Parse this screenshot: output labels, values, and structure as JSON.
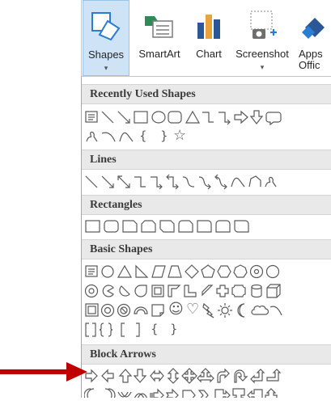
{
  "ribbon": {
    "buttons": [
      {
        "label": "Shapes",
        "icon": "shapes-icon"
      },
      {
        "label": "SmartArt",
        "icon": "smartart-icon"
      },
      {
        "label": "Chart",
        "icon": "chart-icon"
      },
      {
        "label": "Screenshot",
        "icon": "screenshot-icon"
      },
      {
        "label": "Apps",
        "label2": "Offic",
        "icon": "apps-for-office-icon"
      }
    ],
    "dropdown_caret": "▾"
  },
  "gallery": {
    "sections": [
      {
        "title": "Recently Used Shapes"
      },
      {
        "title": "Lines"
      },
      {
        "title": "Rectangles"
      },
      {
        "title": "Basic Shapes"
      },
      {
        "title": "Block Arrows"
      }
    ],
    "inline_text": {
      "bracket_left": "{",
      "bracket_right": "}",
      "star": "☆",
      "smiley": "☺",
      "heart": "♡"
    }
  },
  "colors": {
    "shape_stroke": "#5a5a5a",
    "header_bg": "#e9e9e9",
    "selected_button": "#cfe3f7",
    "annotation_arrow": "#c00000",
    "accent_blue": "#2b7cd3"
  }
}
